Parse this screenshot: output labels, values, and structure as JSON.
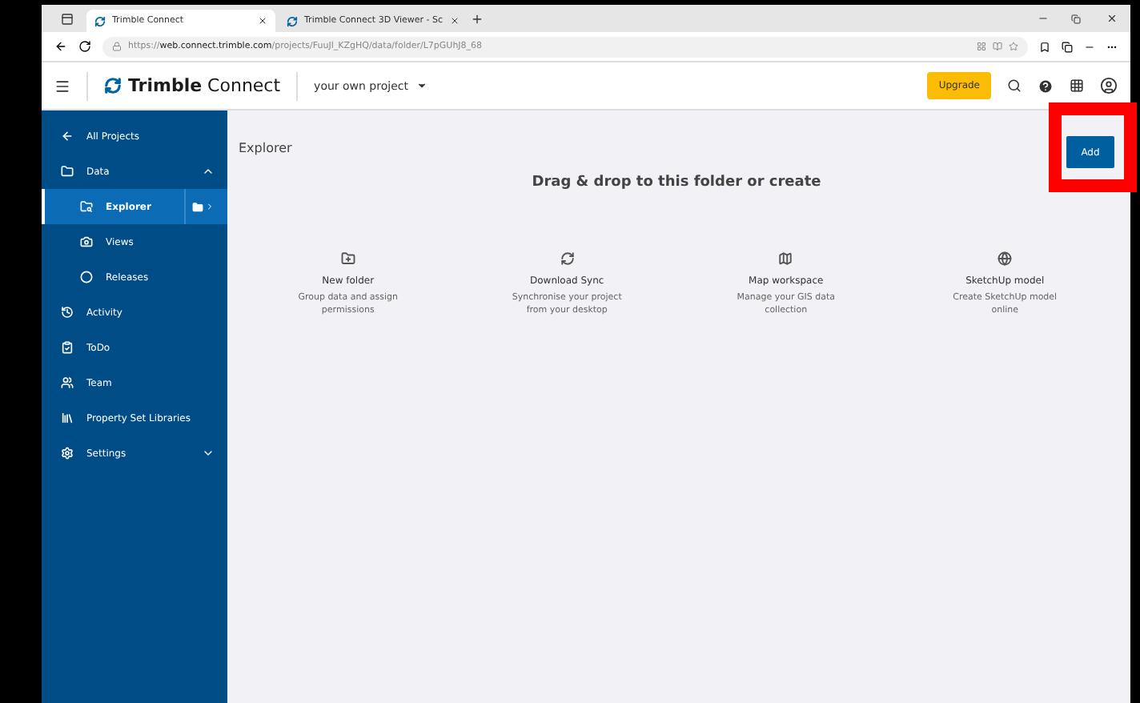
{
  "browser": {
    "tabs": [
      {
        "title": "Trimble Connect",
        "selected": true
      },
      {
        "title": "Trimble Connect 3D Viewer - Sc",
        "selected": false
      }
    ],
    "url": "https://**web.connect.trimble.com**/projects/FuuJl_KZgHQ/data/folder/L7pGUhJ8_68"
  },
  "header": {
    "brand": "**Trimble** Connect",
    "project": "your own project",
    "upgrade": "Upgrade"
  },
  "sidebar": {
    "items": [
      {
        "label": "All Projects",
        "selected": false
      },
      {
        "label": "Data",
        "selected": false,
        "expanded": true,
        "children": [
          {
            "label": "Explorer",
            "selected": true
          },
          {
            "label": "Views",
            "selected": false
          },
          {
            "label": "Releases",
            "selected": false
          }
        ]
      },
      {
        "label": "Activity",
        "selected": false
      },
      {
        "label": "ToDo",
        "selected": false
      },
      {
        "label": "Team",
        "selected": false
      },
      {
        "label": "Property Set Libraries",
        "selected": false
      },
      {
        "label": "Settings",
        "selected": false,
        "expanded": false
      }
    ]
  },
  "content": {
    "title": "Explorer",
    "add_button": {
      "label": "Add",
      "highlighted": true
    },
    "heading": "Drag & drop to this folder or create",
    "actions": [
      {
        "title": "New folder",
        "description": "Group data and assign permissions"
      },
      {
        "title": "Download Sync",
        "description": "Synchronise your project from your desktop"
      },
      {
        "title": "Map workspace",
        "description": "Manage your GIS data collection"
      },
      {
        "title": "SketchUp model",
        "description": "Create SketchUp model online"
      }
    ]
  }
}
